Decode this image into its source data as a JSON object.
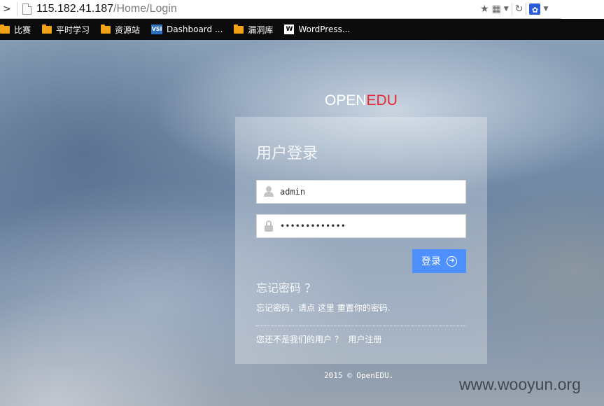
{
  "browser": {
    "url_host": "115.182.41.187",
    "url_path": "/Home/Login",
    "bookmarks": [
      {
        "label": "比赛",
        "icon": "folder-icon"
      },
      {
        "label": "平时学习",
        "icon": "folder-icon"
      },
      {
        "label": "资源站",
        "icon": "folder-icon"
      },
      {
        "label": "Dashboard ...",
        "icon": "vsi-icon"
      },
      {
        "label": "漏洞库",
        "icon": "folder-icon"
      },
      {
        "label": "WordPress...",
        "icon": "wordpress-icon"
      }
    ]
  },
  "brand": {
    "part1": "OPEN",
    "part2": "EDU",
    "part2_color": "#e8262c"
  },
  "login": {
    "title": "用户登录",
    "username": "admin",
    "password": "•••••••••••••",
    "button_label": "登录"
  },
  "forgot": {
    "title": "忘记密码 ？",
    "text_prefix": "忘记密码，请点",
    "link_label": "这里",
    "text_suffix": "重置你的密码."
  },
  "register": {
    "text": "您还不是我们的用户 ？",
    "link_label": "用户注册"
  },
  "footer": {
    "copyright": "2015 © OpenEDU."
  },
  "watermark": "www.wooyun.org",
  "colors": {
    "button": "#4d90fe",
    "bookmark_bar": "#0b0b0b"
  }
}
